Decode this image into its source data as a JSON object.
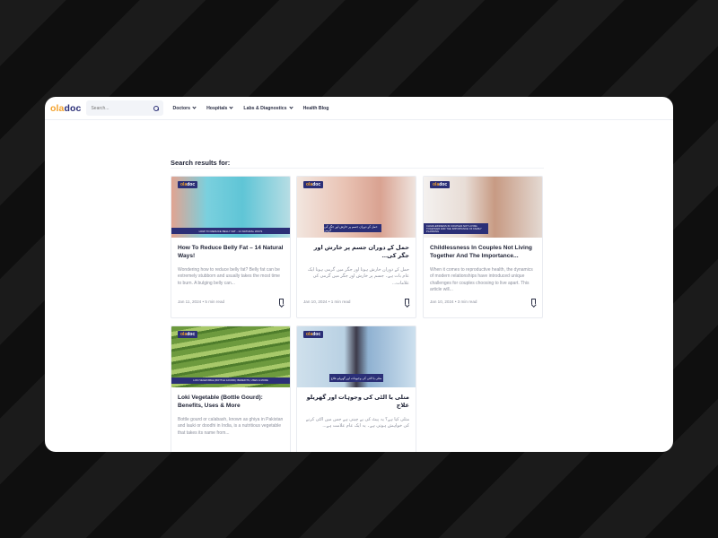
{
  "logo": {
    "o1": "o",
    "rest": "la",
    "doc": "doc"
  },
  "search": {
    "placeholder": "Search..."
  },
  "menu": [
    {
      "label": "Doctors",
      "has_dropdown": true
    },
    {
      "label": "Hospitals",
      "has_dropdown": true
    },
    {
      "label": "Labs & Diagnostics",
      "has_dropdown": true
    },
    {
      "label": "Health Blog",
      "has_dropdown": false
    }
  ],
  "results_title": "Search results for:",
  "brand_badge": {
    "ola": "ola",
    "doc": "doc"
  },
  "cards": [
    {
      "banner": "How to Reduce Belly Fat - 14 Natural Ways",
      "title": "How To Reduce Belly Fat – 14 Natural Ways!",
      "excerpt": "Wondering how to reduce belly fat? Belly fat can be extremely stubborn and usually takes the most time to burn. A bulging belly can...",
      "meta": "Jan 11, 2024 • 5 min read",
      "rtl": false
    },
    {
      "banner": "حمل کے دوران جسم پر خارش اور جگر کی گرمی",
      "title": "حمل کے دوران جسم پر خارش اور جگر کی...",
      "excerpt": "حمل کے دوران خارش ہونا اور جگر میں گرمی ہونا ایک عام بات ہے۔ جسم پر خارش اور جگر میں گرمی کی علامات...",
      "meta": "Jan 10, 2024 • 1 min read",
      "rtl": true
    },
    {
      "banner": "Childlessness in Couples Not Living Together and the Importance of Family Planning",
      "title": "Childlessness In Couples Not Living Together And The Importance...",
      "excerpt": "When it comes to reproductive health, the dynamics of modern relationships have introduced unique challenges for couples choosing to live apart. This article will...",
      "meta": "Jan 10, 2024 • 3 min read",
      "rtl": false
    },
    {
      "banner": "Loki Vegetable (Bottle Gourd): Benefits, Uses & More",
      "title": "Loki Vegetable (Bottle Gourd): Benefits, Uses & More",
      "excerpt": "Bottle gourd or calabash, known as ghiya in Pakistan and lauki or doodhi in India, is a nutritious vegetable that takes its name from...",
      "meta": "",
      "rtl": false
    },
    {
      "banner": "متلی یا الٹی کی وجوہات اور گھریلو علاج",
      "title": "متلی یا الٹی کی وجوہات اور گھریلو علاج",
      "excerpt": "متلی کیا ہے؟ یہ پیٹ کی بے چینی ہے جس میں الٹی کرنے کی خواہش ہوتی ہے۔ یہ ایک عام علامت ہے...",
      "meta": "",
      "rtl": true
    }
  ]
}
